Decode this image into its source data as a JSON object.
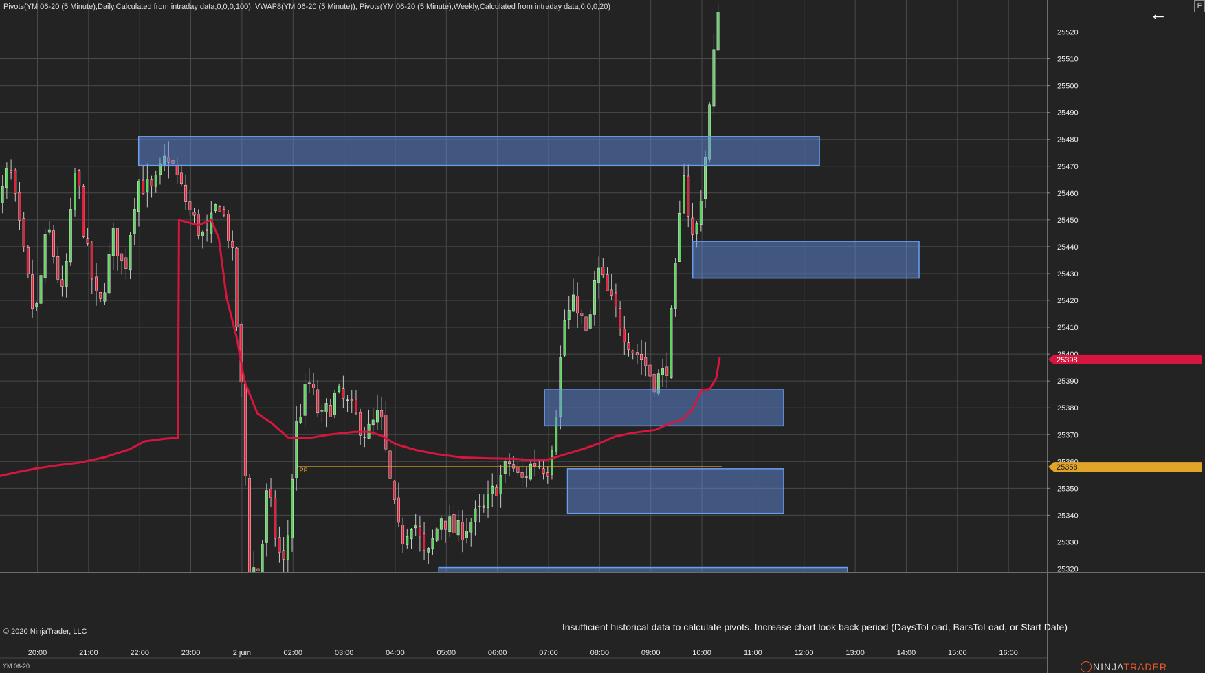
{
  "indicator_label": "Pivots(YM 06-20 (5 Minute),Daily,Calculated from intraday data,0,0,0,100), VWAP8(YM 06-20 (5 Minute)), Pivots(YM 06-20 (5 Minute),Weekly,Calculated from intraday data,0,0,0,20)",
  "copyright": "© 2020 NinjaTrader, LLC",
  "warning": "Insufficient historical data to calculate pivots. Increase chart look back period (DaysToLoad, BarsToLoad, or Start Date)",
  "instrument": "YM 06-20",
  "logo_prefix": "NINJA",
  "logo_suffix": "TRADER",
  "back_icon": "←",
  "f_button": "F",
  "colors": {
    "background": "#232323",
    "grid": "#4a4a4a",
    "up_candle": "#5fd35f",
    "down_candle": "#e0233c",
    "vwap": "#d6163e",
    "pivot_line": "#e0a428",
    "zone_fill": "rgba(96,140,220,0.50)",
    "zone_stroke": "#6a9ef0",
    "price_badge_red": "#d6163e",
    "price_badge_gold": "#e0a428"
  },
  "chart_data": {
    "type": "candlestick",
    "x_ticks": [
      "20:00",
      "21:00",
      "22:00",
      "23:00",
      "2 juin",
      "02:00",
      "03:00",
      "04:00",
      "05:00",
      "06:00",
      "07:00",
      "08:00",
      "09:00",
      "10:00",
      "11:00",
      "12:00",
      "13:00",
      "14:00",
      "15:00",
      "16:00"
    ],
    "y_ticks": [
      25320,
      25330,
      25340,
      25350,
      25360,
      25370,
      25380,
      25390,
      25400,
      25410,
      25420,
      25430,
      25440,
      25450,
      25460,
      25470,
      25480,
      25490,
      25500,
      25510,
      25520
    ],
    "ylim": [
      25317,
      25539
    ],
    "x_range_hours": [
      19.2,
      16.4
    ],
    "bar_minutes": 5,
    "anchors_close": [
      [
        19.15,
        25448
      ],
      [
        19.45,
        25470
      ],
      [
        19.7,
        25440
      ],
      [
        19.95,
        25412
      ],
      [
        20.2,
        25448
      ],
      [
        20.5,
        25420
      ],
      [
        20.75,
        25470
      ],
      [
        20.95,
        25440
      ],
      [
        21.2,
        25415
      ],
      [
        21.5,
        25445
      ],
      [
        21.7,
        25430
      ],
      [
        21.95,
        25465
      ],
      [
        22.25,
        25460
      ],
      [
        22.55,
        25475
      ],
      [
        22.8,
        25462
      ],
      [
        23.05,
        25450
      ],
      [
        23.3,
        25442
      ],
      [
        23.55,
        25458
      ],
      [
        23.8,
        25440
      ],
      [
        24.0,
        25382
      ],
      [
        24.15,
        25320
      ],
      [
        24.35,
        25320
      ],
      [
        24.5,
        25350
      ],
      [
        24.7,
        25327
      ],
      [
        24.85,
        25320
      ],
      [
        25.05,
        25372
      ],
      [
        25.3,
        25390
      ],
      [
        25.55,
        25375
      ],
      [
        25.85,
        25385
      ],
      [
        26.1,
        25380
      ],
      [
        26.45,
        25370
      ],
      [
        26.7,
        25378
      ],
      [
        26.95,
        25345
      ],
      [
        27.1,
        25330
      ],
      [
        27.35,
        25340
      ],
      [
        27.6,
        25322
      ],
      [
        27.9,
        25340
      ],
      [
        28.2,
        25333
      ],
      [
        28.5,
        25338
      ],
      [
        28.75,
        25342
      ],
      [
        29.0,
        25352
      ],
      [
        29.25,
        25360
      ],
      [
        29.45,
        25352
      ],
      [
        29.7,
        25360
      ],
      [
        30.0,
        25358
      ],
      [
        30.15,
        25380
      ],
      [
        30.3,
        25412
      ],
      [
        30.55,
        25420
      ],
      [
        30.75,
        25405
      ],
      [
        30.95,
        25432
      ],
      [
        31.2,
        25420
      ],
      [
        31.45,
        25410
      ],
      [
        31.65,
        25402
      ],
      [
        31.85,
        25398
      ],
      [
        32.05,
        25390
      ],
      [
        32.3,
        25393
      ],
      [
        32.5,
        25433
      ],
      [
        32.65,
        25470
      ],
      [
        32.75,
        25450
      ],
      [
        32.85,
        25440
      ],
      [
        33.05,
        25470
      ],
      [
        33.2,
        25502
      ],
      [
        33.35,
        25539
      ]
    ],
    "vwap": [
      [
        19.12,
        25354
      ],
      [
        19.6,
        25356
      ],
      [
        20.0,
        25357.5
      ],
      [
        20.4,
        25358.6
      ],
      [
        20.8,
        25359.5
      ],
      [
        21.3,
        25361.5
      ],
      [
        21.8,
        25364.5
      ],
      [
        22.1,
        25367.5
      ],
      [
        22.5,
        25368.5
      ],
      [
        22.75,
        25368.8
      ],
      [
        22.77,
        25450
      ],
      [
        22.95,
        25449
      ],
      [
        23.15,
        25448
      ],
      [
        23.4,
        25450
      ],
      [
        23.55,
        25443
      ],
      [
        23.7,
        25421
      ],
      [
        23.9,
        25406
      ],
      [
        24.05,
        25390
      ],
      [
        24.3,
        25378
      ],
      [
        24.6,
        25374
      ],
      [
        24.9,
        25369
      ],
      [
        25.3,
        25368.7
      ],
      [
        25.7,
        25370
      ],
      [
        26.2,
        25371
      ],
      [
        26.5,
        25371
      ],
      [
        26.75,
        25369.5
      ],
      [
        27.0,
        25366.5
      ],
      [
        27.4,
        25364.3
      ],
      [
        27.8,
        25362.8
      ],
      [
        28.3,
        25361.5
      ],
      [
        28.8,
        25361.2
      ],
      [
        29.3,
        25361
      ],
      [
        29.7,
        25360.5
      ],
      [
        30.0,
        25360.8
      ],
      [
        30.3,
        25362.5
      ],
      [
        30.7,
        25364.8
      ],
      [
        31.0,
        25366.8
      ],
      [
        31.3,
        25369.3
      ],
      [
        31.6,
        25370.5
      ],
      [
        31.9,
        25371.3
      ],
      [
        32.1,
        25371.8
      ],
      [
        32.35,
        25374
      ],
      [
        32.6,
        25375.5
      ],
      [
        32.8,
        25379
      ],
      [
        33.0,
        25386.5
      ],
      [
        33.15,
        25386.8
      ],
      [
        33.28,
        25391
      ],
      [
        33.35,
        25399
      ]
    ],
    "pivot_line": {
      "value": 25358,
      "label": "PP",
      "from": 25.1,
      "to": 33.4
    },
    "zones": [
      {
        "from": 21.98,
        "to": 35.3,
        "top": 25481,
        "bottom": 25470.3
      },
      {
        "from": 32.82,
        "to": 37.25,
        "top": 25442,
        "bottom": 25428.3
      },
      {
        "from": 29.92,
        "to": 34.6,
        "top": 25386.7,
        "bottom": 25373.3
      },
      {
        "from": 30.37,
        "to": 34.6,
        "top": 25357.3,
        "bottom": 25340.7
      },
      {
        "from": 27.85,
        "to": 35.85,
        "top": 25320.5,
        "bottom": 25317
      }
    ],
    "last_price_vwap": 25398,
    "last_price_pivot": 25358
  }
}
